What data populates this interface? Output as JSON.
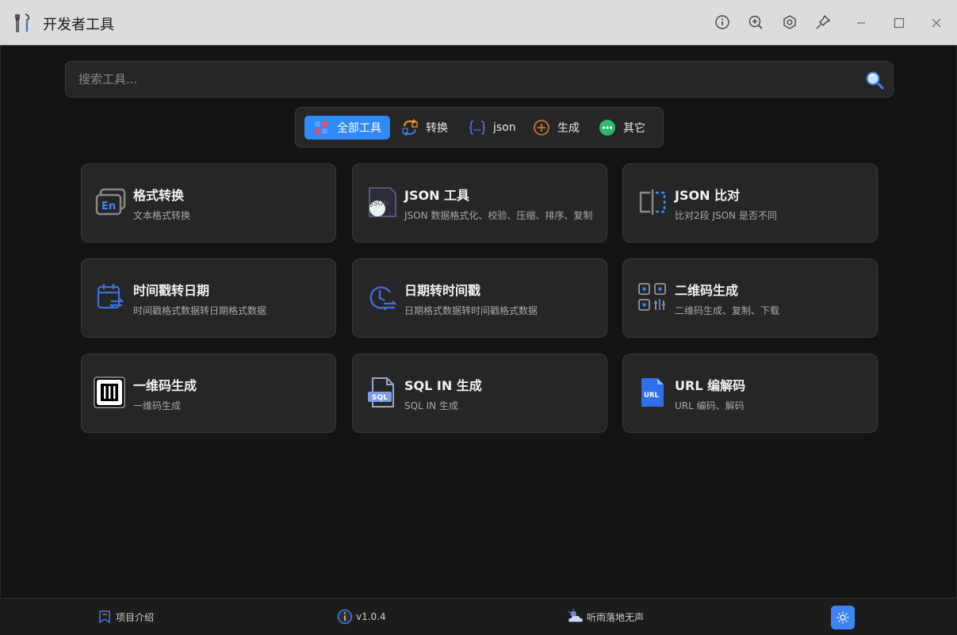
{
  "window": {
    "title": "开发者工具",
    "icons": [
      "info-icon",
      "zoom-in-icon",
      "settings-icon",
      "pin-icon",
      "minimize-icon",
      "maximize-icon",
      "close-icon"
    ]
  },
  "search": {
    "placeholder": "搜索工具..."
  },
  "filters": [
    {
      "label": "全部工具",
      "active": true,
      "icon": "grid-icon"
    },
    {
      "label": "转换",
      "active": false,
      "icon": "convert-icon"
    },
    {
      "label": "json",
      "active": false,
      "icon": "json-braces-icon"
    },
    {
      "label": "生成",
      "active": false,
      "icon": "plus-circle-icon"
    },
    {
      "label": "其它",
      "active": false,
      "icon": "more-icon"
    }
  ],
  "tools": [
    {
      "title": "格式转换",
      "desc": "文本格式转换",
      "icon": "text-format-icon",
      "icon_text": "En"
    },
    {
      "title": "JSON 工具",
      "desc": "JSON 数据格式化、校验、压缩、排序、复制",
      "icon": "json-file-icon",
      "icon_text": "JSON"
    },
    {
      "title": "JSON 比对",
      "desc": "比对2段 JSON 是否不同",
      "icon": "compare-icon"
    },
    {
      "title": "时间戳转日期",
      "desc": "时间戳格式数据转日期格式数据",
      "icon": "calendar-convert-icon"
    },
    {
      "title": "日期转时间戳",
      "desc": "日期格式数据转时间戳格式数据",
      "icon": "clock-convert-icon"
    },
    {
      "title": "二维码生成",
      "desc": "二维码生成、复制、下载",
      "icon": "qrcode-icon"
    },
    {
      "title": "一维码生成",
      "desc": "一维码生成",
      "icon": "barcode-icon"
    },
    {
      "title": "SQL IN 生成",
      "desc": "SQL IN 生成",
      "icon": "sql-file-icon",
      "icon_text": "SQL"
    },
    {
      "title": "URL 编解码",
      "desc": "URL 编码、解码",
      "icon": "url-file-icon",
      "icon_text": "URL"
    }
  ],
  "footer": {
    "project_label": "项目介绍",
    "version": "v1.0.4",
    "author": "听雨落地无声",
    "icons": [
      "bookmark-icon",
      "info-circle-icon",
      "weather-icon",
      "sun-icon"
    ]
  },
  "colors": {
    "accent": "#2f8af5",
    "background": "#141414",
    "card": "#262626",
    "titlebar": "#dcdcdc"
  }
}
